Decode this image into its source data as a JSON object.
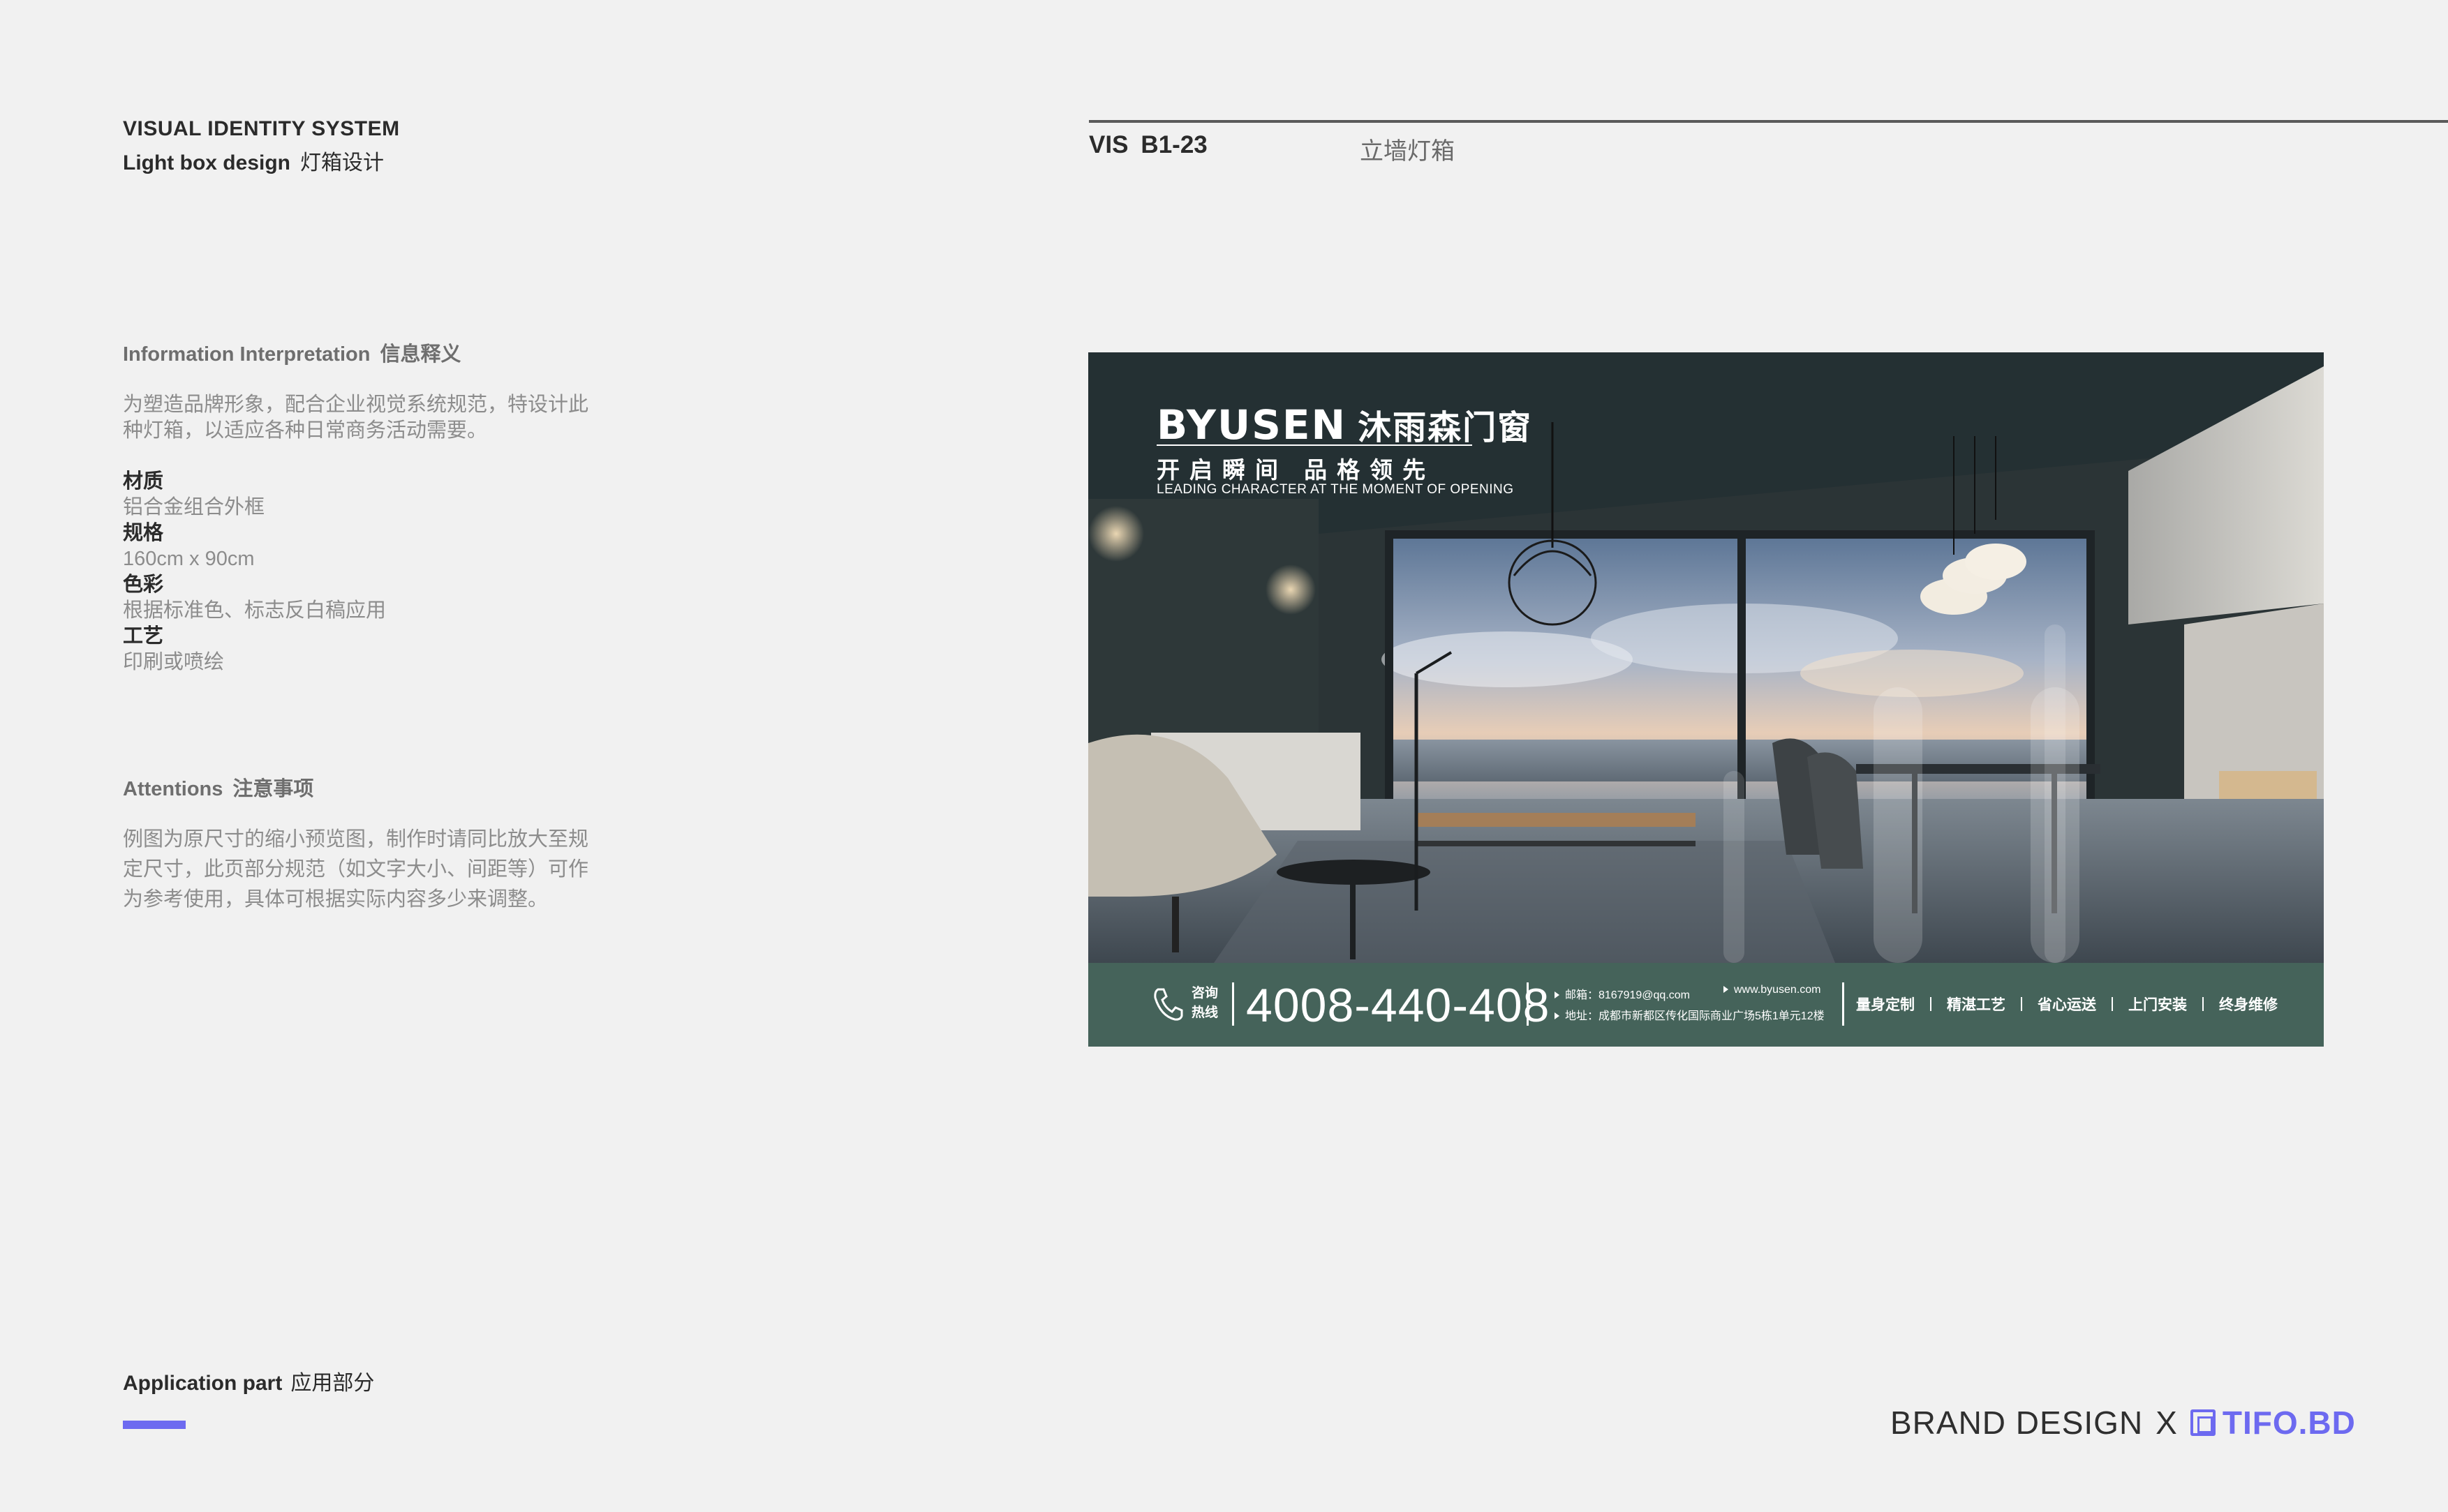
{
  "header": {
    "system_title": "VISUAL IDENTITY SYSTEM",
    "subtitle_en": "Light box design",
    "subtitle_zh": "灯箱设计",
    "vis_label": "VIS",
    "vis_code": "B1-23",
    "item_type": "立墙灯箱"
  },
  "info": {
    "title_en": "Information Interpretation",
    "title_zh": "信息释义",
    "body": "为塑造品牌形象，配合企业视觉系统规范，特设计此种灯箱，以适应各种日常商务活动需要。",
    "specs": [
      {
        "label": "材质",
        "value": "铝合金组合外框"
      },
      {
        "label": "规格",
        "value": "160cm x 90cm"
      },
      {
        "label": "色彩",
        "value": "根据标准色、标志反白稿应用"
      },
      {
        "label": "工艺",
        "value": "印刷或喷绘"
      }
    ]
  },
  "attentions": {
    "title_en": "Attentions",
    "title_zh": "注意事项",
    "body": "例图为原尺寸的缩小预览图，制作时请同比放大至规定尺寸，此页部分规范（如文字大小、间距等）可作为参考使用，具体可根据实际内容多少来调整。"
  },
  "footer": {
    "part_en": "Application part",
    "part_zh": "应用部分",
    "brand_design": "BRAND DESIGN",
    "x": "X",
    "partner": "TIFO.BD",
    "accent_color": "#6d6af0"
  },
  "lightbox": {
    "brand_en": "BYUSEN",
    "brand_zh": "沐雨森门窗",
    "slogan_zh": "开启瞬间 品格领先",
    "slogan_en": "LEADING CHARACTER AT THE MOMENT OF OPENING",
    "hotline_label": "咨询热线",
    "phone": "4008-440-408",
    "email": "邮箱：8167919@qq.com",
    "website": "www.byusen.com",
    "address": "地址：成都市新都区传化国际商业广场5栋1单元12楼",
    "services": [
      "量身定制",
      "精湛工艺",
      "省心运送",
      "上门安装",
      "终身维修"
    ],
    "strip_color": "#45635a",
    "image": "modern living room with floor-to-ceiling windows overlooking lake at sunset"
  }
}
